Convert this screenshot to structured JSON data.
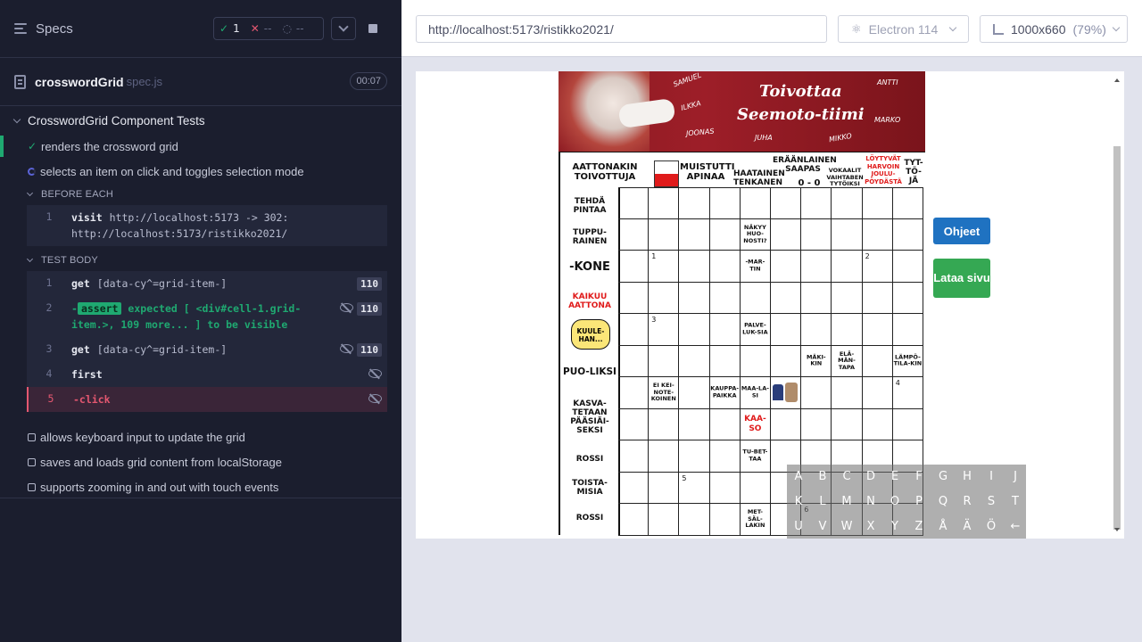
{
  "sidebar": {
    "title": "Specs",
    "stats": {
      "passed": "1",
      "failed": "--",
      "pending": "--"
    },
    "spec_name": "crosswordGrid",
    "spec_ext": "spec.js",
    "duration": "00:07",
    "suite_title": "CrosswordGrid Component Tests",
    "tests": [
      "renders the crossword grid",
      "selects an item on click and toggles selection mode",
      "allows keyboard input to update the grid",
      "saves and loads grid content from localStorage",
      "supports zooming in and out with touch events"
    ],
    "before_each_label": "BEFORE EACH",
    "test_body_label": "TEST BODY",
    "before_cmd": {
      "num": "1",
      "name": "visit",
      "msg": "http://localhost:5173 -> 302: http://localhost:5173/ristikko2021/"
    },
    "commands": [
      {
        "num": "1",
        "name": "get",
        "msg": "[data-cy^=grid-item-]",
        "badge": "110"
      },
      {
        "num": "2",
        "tag": "assert",
        "msg": "expected [ <div#cell-1.grid-item.>, 109 more... ] to be visible",
        "badge": "110"
      },
      {
        "num": "3",
        "name": "get",
        "msg": "[data-cy^=grid-item-]",
        "badge": "110"
      },
      {
        "num": "4",
        "name": "first"
      },
      {
        "num": "5",
        "name": "-click"
      }
    ]
  },
  "browser": {
    "url": "http://localhost:5173/ristikko2021/",
    "browser_name": "Electron 114",
    "viewport": "1000x660",
    "zoom": "(79%)"
  },
  "puzzle": {
    "banner_title_1": "Toivottaa",
    "banner_title_2": "Seemoto-tiimi",
    "names": [
      "SAMUEL",
      "ILKKA",
      "JOONAS",
      "JUHA",
      "MIKKO",
      "MARKO",
      "ANTTI"
    ],
    "top_clues": {
      "c1": "AATTONAKIN TOIVOTTUJA",
      "c2": "MUISTUTTI APINAA",
      "c3": "HAATAINEN TENKANEN",
      "c4": "ERÄÄNLAINEN SAAPAS",
      "c4b": "0 - 0",
      "c5": "VOKAALIT VAIHTABEN TYTÖIKSI",
      "c6": "LÖYTYVÄT HARVOIN JOULU-PÖYDÄSTÄ",
      "c7": "TYT-TÖ-JÄ"
    },
    "side_clues": [
      "TEHDÄ PINTAA",
      "TUPPU-RAINEN",
      "-KONE",
      "KAIKUU AATTONA",
      "KUULE-HAN...",
      "PUO-LIKSI",
      "KASVA-TETAAN PÄÄSIÄI-SEKSI",
      "ROSSI",
      "TOISTA-MISIA",
      "ROSSI"
    ],
    "grid_clues": {
      "nakyy": "NÄKYY HUO-NOSTI?",
      "martin": "-MAR-TIN",
      "palve": "PALVE-LUK-SIA",
      "makikin": "MÄKI-KIN",
      "elamantapa": "ELÄ-MÄN-TAPA",
      "lampo": "LÄMPÖ-TILA-KIN",
      "eikei": "EI KEI-NOTE-KOINEN",
      "kauppa": "KAUPPA-PAIKKA",
      "maalasi": "MAA-LA-SI",
      "kaaso": "KAA-SO",
      "tubettaa": "TU-BET-TAA",
      "metsalakin": "MET-SÄL-LAKIN"
    },
    "numbers": {
      "n1": "1",
      "n2": "2",
      "n3": "3",
      "n4": "4",
      "n5": "5",
      "n6": "6"
    },
    "keyboard": [
      [
        "A",
        "B",
        "C",
        "D",
        "E",
        "F",
        "G",
        "H",
        "I",
        "J"
      ],
      [
        "K",
        "L",
        "M",
        "N",
        "O",
        "P",
        "Q",
        "R",
        "S",
        "T"
      ],
      [
        "U",
        "V",
        "W",
        "X",
        "Y",
        "Z",
        "Å",
        "Ä",
        "Ö",
        "←"
      ]
    ],
    "btn_ohjeet": "Ohjeet",
    "btn_lataa": "Lataa sivu"
  }
}
